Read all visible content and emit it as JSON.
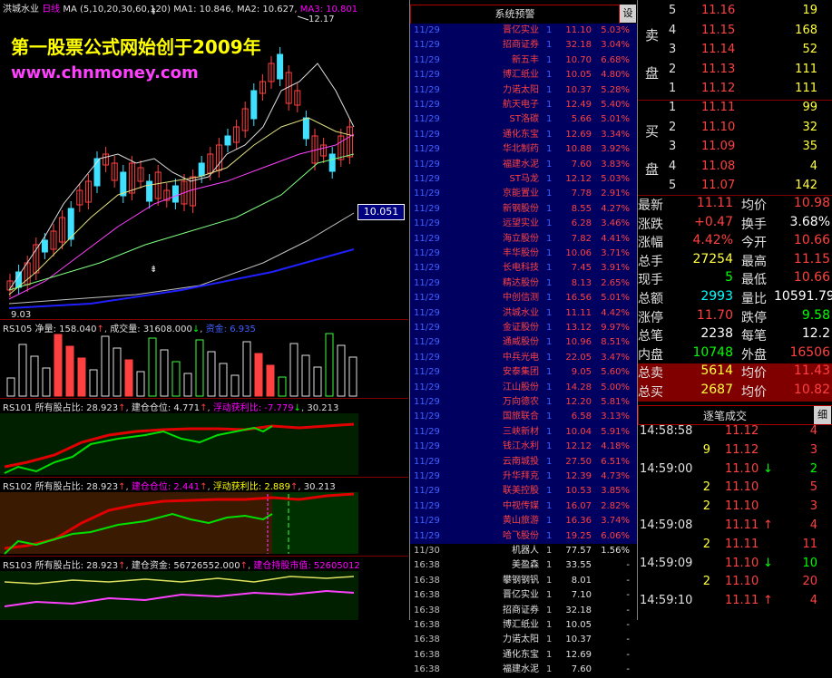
{
  "main": {
    "stock": "洪城水业",
    "period": "日线",
    "ma_label": "MA (5,10,20,30,60,120)",
    "ma1": "MA1: 10.846",
    "ma2": "MA2: 10.627",
    "ma3": "MA3: 10.801",
    "high_mark": "12.17",
    "low_mark": "9.03",
    "price_tag": "10.051",
    "watermark1": "第一股票公式网始创于2009年",
    "watermark2": "www.chnmoney.com"
  },
  "rs105": {
    "name": "RS105",
    "jl_label": "净量:",
    "jl_val": "158.040",
    "cj_label": "成交量:",
    "cj_val": "31608.000",
    "tail": "资金: 6.935"
  },
  "rs101": {
    "name": "RS101",
    "t1": "所有股占比: 28.923",
    "t2": "建仓仓位: 4.771",
    "t3": "浮动获利比: -7.779",
    "t4": "30.213"
  },
  "rs102": {
    "name": "RS102",
    "t1": "所有股占比: 28.923",
    "t2": "建仓仓位: 2.441",
    "t3": "浮动获利比: 2.889",
    "t4": "30.213"
  },
  "rs103": {
    "name": "RS103",
    "t1": "所有股占比: 28.923",
    "t2": "建仓资金: 56726552.000",
    "t3": "建仓持股市值: 52605012"
  },
  "alerts": {
    "title": "系统预警",
    "settings": "设",
    "rows": [
      [
        "11/29",
        "晋亿实业",
        "1",
        "11.10",
        "5.03%"
      ],
      [
        "11/29",
        "招商证券",
        "1",
        "32.18",
        "3.04%"
      ],
      [
        "11/29",
        "新五丰",
        "1",
        "10.70",
        "6.68%"
      ],
      [
        "11/29",
        "博汇纸业",
        "1",
        "10.05",
        "4.80%"
      ],
      [
        "11/29",
        "力诺太阳",
        "1",
        "10.37",
        "5.28%"
      ],
      [
        "11/29",
        "航天电子",
        "1",
        "12.49",
        "5.40%"
      ],
      [
        "11/29",
        "ST洛碳",
        "1",
        "5.66",
        "5.01%"
      ],
      [
        "11/29",
        "通化东宝",
        "1",
        "12.69",
        "3.34%"
      ],
      [
        "11/29",
        "华北制药",
        "1",
        "10.88",
        "3.92%"
      ],
      [
        "11/29",
        "福建水泥",
        "1",
        "7.60",
        "3.83%"
      ],
      [
        "11/29",
        "ST马龙",
        "1",
        "12.12",
        "5.03%"
      ],
      [
        "11/29",
        "京能置业",
        "1",
        "7.78",
        "2.91%"
      ],
      [
        "11/29",
        "新钢股份",
        "1",
        "8.55",
        "4.27%"
      ],
      [
        "11/29",
        "远望实业",
        "1",
        "6.28",
        "3.46%"
      ],
      [
        "11/29",
        "海立股份",
        "1",
        "7.82",
        "4.41%"
      ],
      [
        "11/29",
        "丰华股份",
        "1",
        "10.06",
        "3.71%"
      ],
      [
        "11/29",
        "长电科技",
        "1",
        "7.45",
        "3.91%"
      ],
      [
        "11/29",
        "精达股份",
        "1",
        "8.13",
        "2.65%"
      ],
      [
        "11/29",
        "中创信测",
        "1",
        "16.56",
        "5.01%"
      ],
      [
        "11/29",
        "洪城水业",
        "1",
        "11.11",
        "4.42%"
      ],
      [
        "11/29",
        "金证股份",
        "1",
        "13.12",
        "9.97%"
      ],
      [
        "11/29",
        "通威股份",
        "1",
        "10.96",
        "8.51%"
      ],
      [
        "11/29",
        "中兵光电",
        "1",
        "22.05",
        "3.47%"
      ],
      [
        "11/29",
        "安泰集团",
        "1",
        "9.05",
        "5.60%"
      ],
      [
        "11/29",
        "江山股份",
        "1",
        "14.28",
        "5.00%"
      ],
      [
        "11/29",
        "万向德农",
        "1",
        "12.20",
        "5.81%"
      ],
      [
        "11/29",
        "国旅联合",
        "1",
        "6.58",
        "3.13%"
      ],
      [
        "11/29",
        "三峡新材",
        "1",
        "10.04",
        "5.91%"
      ],
      [
        "11/29",
        "钱江水利",
        "1",
        "12.12",
        "4.18%"
      ],
      [
        "11/29",
        "云南城投",
        "1",
        "27.50",
        "6.51%"
      ],
      [
        "11/29",
        "升华拜克",
        "1",
        "12.39",
        "4.73%"
      ],
      [
        "11/29",
        "联美控股",
        "1",
        "10.53",
        "3.85%"
      ],
      [
        "11/29",
        "中视传媒",
        "1",
        "16.07",
        "2.82%"
      ],
      [
        "11/29",
        "黄山旅游",
        "1",
        "16.36",
        "3.74%"
      ],
      [
        "11/29",
        "哈飞股份",
        "1",
        "19.25",
        "6.06%"
      ],
      [
        "11/30",
        "机器人",
        "1",
        "77.57",
        "1.56%"
      ],
      [
        "16:38",
        "美盈森",
        "1",
        "33.55",
        "-"
      ],
      [
        "16:38",
        "攀钢钢钒",
        "1",
        "8.01",
        "-"
      ],
      [
        "16:38",
        "晋亿实业",
        "1",
        "7.10",
        "-"
      ],
      [
        "16:38",
        "招商证券",
        "1",
        "32.18",
        "-"
      ],
      [
        "16:38",
        "博汇纸业",
        "1",
        "10.05",
        "-"
      ],
      [
        "16:38",
        "力诺太阳",
        "1",
        "10.37",
        "-"
      ],
      [
        "16:38",
        "通化东宝",
        "1",
        "12.69",
        "-"
      ],
      [
        "16:38",
        "福建水泥",
        "1",
        "7.60",
        "-"
      ]
    ]
  },
  "orderbook": {
    "sell_label": [
      "卖",
      "盘"
    ],
    "buy_label": [
      "买",
      "盘"
    ],
    "sell": [
      [
        "5",
        "11.16",
        "19"
      ],
      [
        "4",
        "11.15",
        "168"
      ],
      [
        "3",
        "11.14",
        "52"
      ],
      [
        "2",
        "11.13",
        "111"
      ],
      [
        "1",
        "11.12",
        "111"
      ]
    ],
    "buy": [
      [
        "1",
        "11.11",
        "99"
      ],
      [
        "2",
        "11.10",
        "32"
      ],
      [
        "3",
        "11.09",
        "35"
      ],
      [
        "4",
        "11.08",
        "4"
      ],
      [
        "5",
        "11.07",
        "142"
      ]
    ]
  },
  "stats": [
    [
      "最新",
      "11.11",
      "均价",
      "10.98"
    ],
    [
      "涨跌",
      "+0.47",
      "换手",
      "3.68%"
    ],
    [
      "涨幅",
      "4.42%",
      "今开",
      "10.66"
    ],
    [
      "总手",
      "27254",
      "最高",
      "11.15"
    ],
    [
      "现手",
      "5",
      "最低",
      "10.66"
    ],
    [
      "总额",
      "2993",
      "量比",
      "10591.79"
    ],
    [
      "涨停",
      "11.70",
      "跌停",
      "9.58"
    ],
    [
      "总笔",
      "2238",
      "每笔",
      "12.2"
    ],
    [
      "内盘",
      "10748",
      "外盘",
      "16506"
    ],
    [
      "总卖",
      "5614",
      "均价",
      "11.43"
    ],
    [
      "总买",
      "2687",
      "均价",
      "10.82"
    ]
  ],
  "trades": {
    "title": "逐笔成交",
    "detail": "细",
    "rows": [
      [
        "14:58:58",
        "11.12",
        "4",
        ""
      ],
      [
        "",
        "11.12",
        "3",
        ""
      ],
      [
        "14:59:00",
        "11.10",
        "2",
        "down"
      ],
      [
        "",
        "11.10",
        "5",
        ""
      ],
      [
        "",
        "11.10",
        "3",
        ""
      ],
      [
        "14:59:08",
        "11.11",
        "4",
        "up"
      ],
      [
        "",
        "11.11",
        "11",
        ""
      ],
      [
        "14:59:09",
        "11.10",
        "10",
        "down"
      ],
      [
        "",
        "11.10",
        "20",
        ""
      ],
      [
        "14:59:10",
        "11.11",
        "4",
        "up"
      ]
    ],
    "left_counts": [
      "",
      "9",
      "",
      "2",
      "2",
      "",
      "2",
      "",
      "2",
      ""
    ]
  }
}
